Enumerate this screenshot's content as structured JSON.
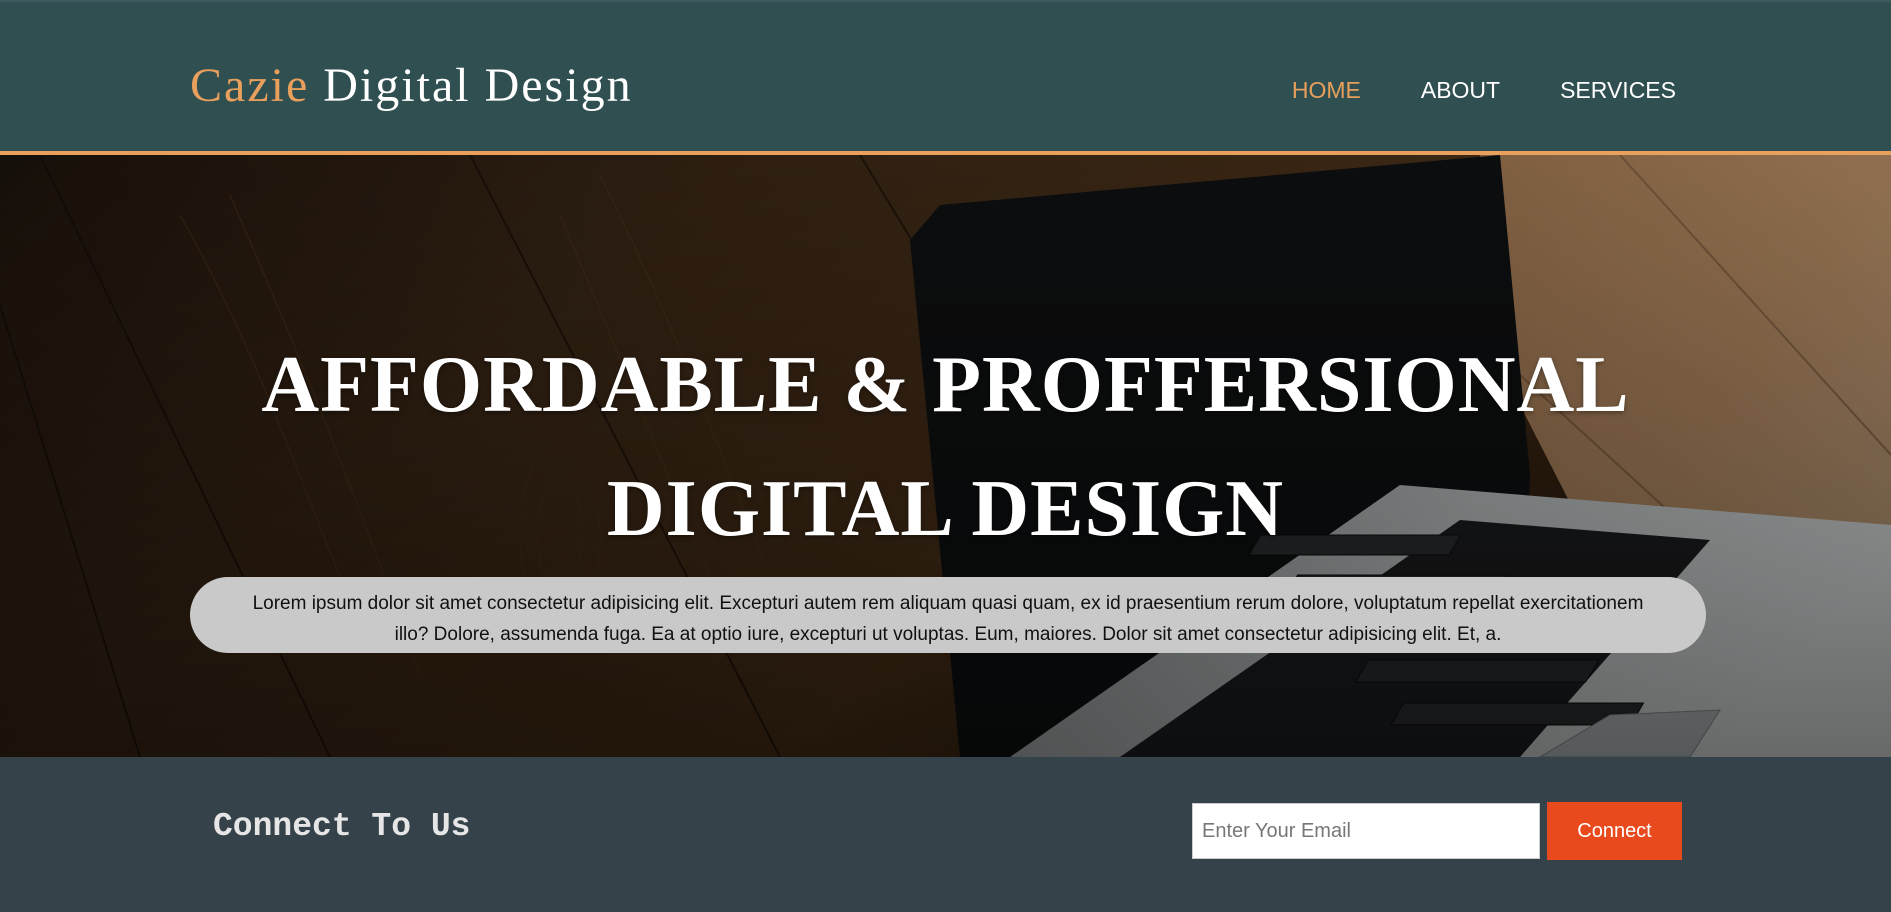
{
  "colors": {
    "header_bg": "#2f4f51",
    "accent": "#e8a05c",
    "nav_text": "#ffffff",
    "footer_bg": "#35424a",
    "button_bg": "#e8491d",
    "textbox_bg": "#c9c9c9"
  },
  "header": {
    "logo_highlight": "Cazie",
    "logo_rest": "Digital Design",
    "nav": [
      {
        "label": "HOME",
        "active": true
      },
      {
        "label": "ABOUT",
        "active": false
      },
      {
        "label": "SERVICES",
        "active": false
      }
    ]
  },
  "hero": {
    "headline_line1": "AFFORDABLE & PROFFERSIONAL",
    "headline_line2": "DIGITAL DESIGN",
    "background_image": "laptop-on-wooden-desk",
    "text": "Lorem ipsum dolor sit amet consectetur adipisicing elit. Excepturi autem rem aliquam quasi quam, ex id praesentium rerum dolore, voluptatum repellat exercitationem illo? Dolore, assumenda fuga. Ea at optio iure, excepturi ut voluptas. Eum, maiores. Dolor sit amet consectetur adipisicing elit. Et, a."
  },
  "newsletter": {
    "title": "Connect To Us",
    "email_placeholder": "Enter Your Email",
    "email_value": "",
    "button_label": "Connect"
  }
}
